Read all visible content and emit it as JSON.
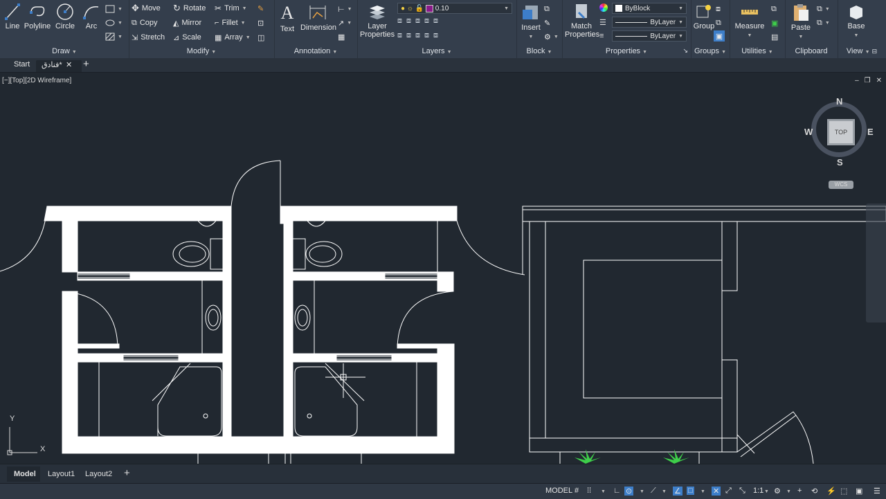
{
  "ribbon": {
    "draw": {
      "title": "Draw",
      "line": "Line",
      "polyline": "Polyline",
      "circle": "Circle",
      "arc": "Arc"
    },
    "modify": {
      "title": "Modify",
      "move": "Move",
      "rotate": "Rotate",
      "trim": "Trim",
      "copy": "Copy",
      "mirror": "Mirror",
      "fillet": "Fillet",
      "stretch": "Stretch",
      "scale": "Scale",
      "array": "Array"
    },
    "annotation": {
      "title": "Annotation",
      "text": "Text",
      "dimension": "Dimension"
    },
    "layers": {
      "title": "Layers",
      "layer_properties_1": "Layer",
      "layer_properties_2": "Properties",
      "current_layer": "0.10"
    },
    "block": {
      "title": "Block",
      "insert": "Insert"
    },
    "properties": {
      "title": "Properties",
      "match_1": "Match",
      "match_2": "Properties",
      "color": "ByBlock",
      "linetype": "ByLayer",
      "lineweight": "ByLayer"
    },
    "groups": {
      "title": "Groups",
      "group": "Group"
    },
    "utilities": {
      "title": "Utilities",
      "measure": "Measure"
    },
    "clipboard": {
      "title": "Clipboard",
      "paste": "Paste"
    },
    "view": {
      "title": "View",
      "base": "Base"
    }
  },
  "file_tabs": {
    "start": "Start",
    "drawing": "فنادق*"
  },
  "viewport": {
    "label": "[−][Top][2D Wireframe]"
  },
  "viewcube": {
    "n": "N",
    "s": "S",
    "e": "E",
    "w": "W",
    "top": "TOP",
    "wcs": "WCS"
  },
  "ucs": {
    "x": "X",
    "y": "Y"
  },
  "layout_tabs": {
    "model": "Model",
    "layout1": "Layout1",
    "layout2": "Layout2"
  },
  "status": {
    "model": "MODEL",
    "scale": "1:1"
  },
  "colors": {
    "ribbon_bg": "#343e4c",
    "canvas_bg": "#212830",
    "accent_blue": "#3d7ec9",
    "plant_green": "#3ecf4a"
  }
}
